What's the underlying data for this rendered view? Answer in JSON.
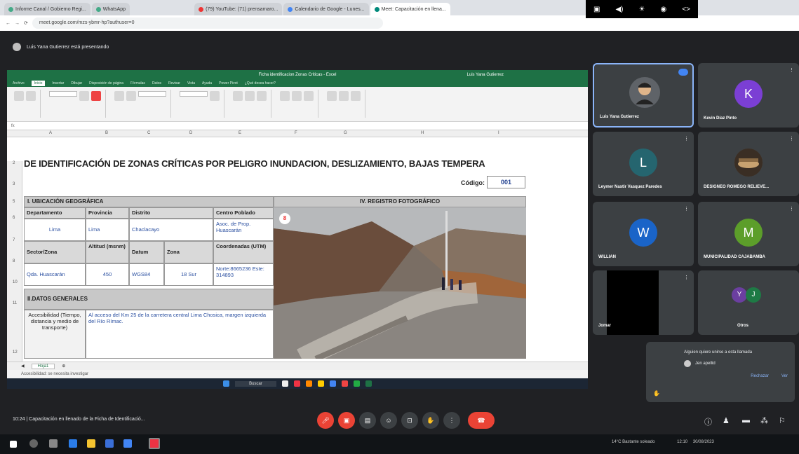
{
  "browser": {
    "tabs": [
      {
        "label": "Informe Canal / Gobierno Regi..."
      },
      {
        "label": "WhatsApp"
      },
      {
        "label": "(79) YouTube: (71) prensamaro..."
      },
      {
        "label": "Calendario de Google - Lunes..."
      },
      {
        "label": "Meet: Capacitación en llena..."
      }
    ],
    "url": "meet.google.com/mzs-ybmr-hp?authuser=0"
  },
  "meet": {
    "presenting_text": "Luis Yana Gutierrez está presentando",
    "meeting_info": "10:24  |  Capacitación en llenado de la Ficha de Identificació...",
    "participants": [
      {
        "name": "Luis Yana Gutierrez",
        "initial": "",
        "color": "#5f6368"
      },
      {
        "name": "Kevin Díaz Pinto",
        "initial": "K",
        "color": "#7b3fd4"
      },
      {
        "name": "Leymer Nastir Vasquez Paredes",
        "initial": "L",
        "color": "#25656f"
      },
      {
        "name": "DESIGNEO ROMEGO RELIEVE...",
        "initial": "",
        "color": "#5a4a3a"
      },
      {
        "name": "WILLIAN",
        "initial": "W",
        "color": "#1a64c8"
      },
      {
        "name": "MUNICIPALIDAD CAJABAMBA",
        "initial": "M",
        "color": "#5c9e2a"
      },
      {
        "name": "Jomar",
        "initial": "",
        "color": "#000000"
      },
      {
        "name": "Otros",
        "initial": "YJ",
        "color": "#6b3fa0"
      }
    ],
    "notification": {
      "text": "Alguien quiere unirse a esta llamada",
      "person": "Jen apellid",
      "actions": [
        "Rechazar",
        "Ver"
      ]
    }
  },
  "excel": {
    "title": "Ficha identificacion Zonas Criticas - Excel",
    "user": "Luis Yana Gutierrez",
    "menu": [
      "Archivo",
      "Inicio",
      "Insertar",
      "Dibujar",
      "Disposición de página",
      "Fórmulas",
      "Datos",
      "Revisar",
      "Vista",
      "Ayuda",
      "Power Pivot",
      "¿Qué desea hacer?"
    ],
    "sheet_title": "DE IDENTIFICACIÓN DE ZONAS CRÍTICAS POR PELIGRO INUNDACION, DESLIZAMIENTO, BAJAS TEMPERA",
    "codigo_label": "Código:",
    "codigo_value": "001",
    "sec1": "I. UBICACIÓN GEOGRÁFICA",
    "sec4": "IV. REGISTRO FOTOGRÁFICO",
    "sec2": "II.DATOS GENERALES",
    "headers1": [
      "Departamento",
      "Provincia",
      "Distrito",
      "Centro Poblado"
    ],
    "values1": [
      "Lima",
      "Lima",
      "Chaclacayo",
      "Asoc. de Prop. Huascarán"
    ],
    "headers2": [
      "Sector/Zona",
      "Altitud (msnm)",
      "Datum",
      "Zona",
      "Coordenadas (UTM)"
    ],
    "values2": [
      "Qda. Huascarán",
      "450",
      "WGS84",
      "18 Sur",
      "Norte:8665236 Este: 314893"
    ],
    "acc_label": "Accesibilidad (Tiempo, distancia y medio de transporte)",
    "acc_value": "Al acceso del Km 25 de la carretera central Lima Chosica, margen izquierda del Río Rímac.",
    "photo_badge": "8",
    "sheet_tab": "Hoja1",
    "status": "Accesibilidad: se necesita investigar"
  },
  "taskbar": {
    "search": "Buscar",
    "clock": "12:10",
    "date": "30/08/2023",
    "weather": "14°C  Bastante soleado"
  }
}
